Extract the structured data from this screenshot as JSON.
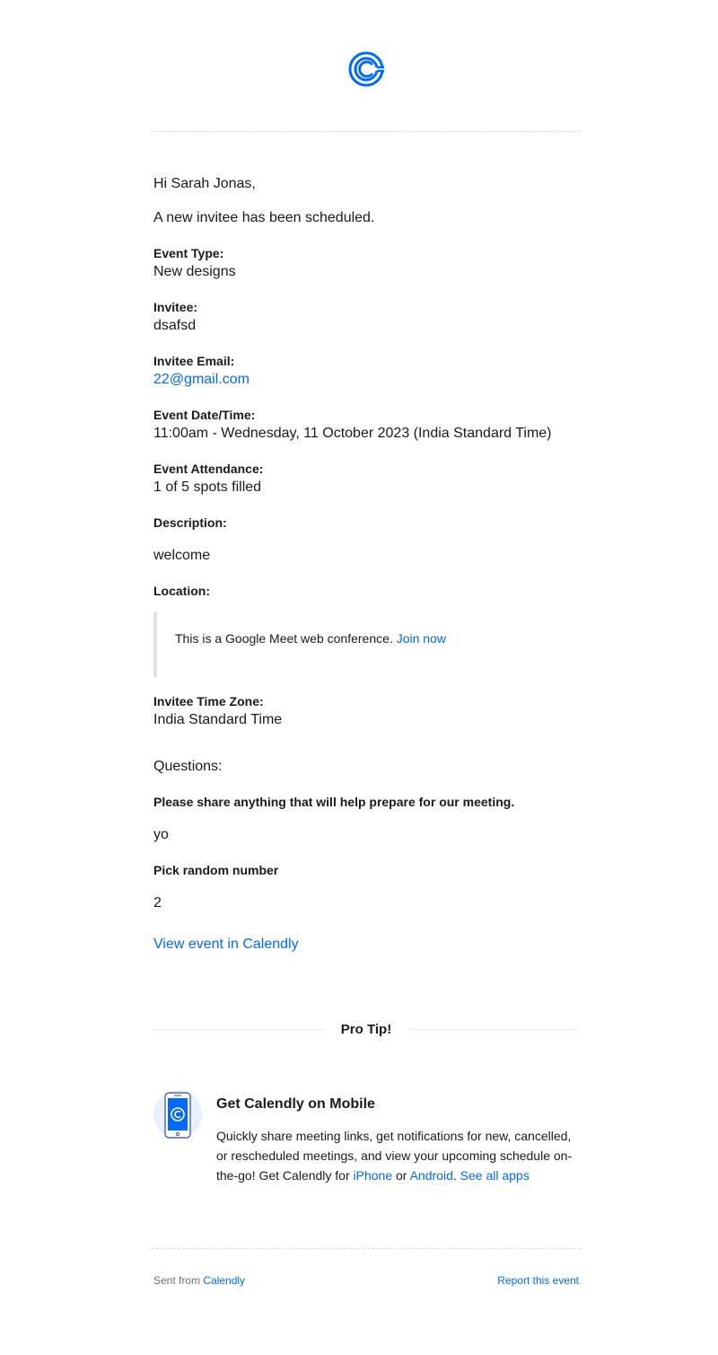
{
  "brand": {
    "logo_icon": "calendly-logo-icon",
    "accent_color": "#0069ff"
  },
  "greeting": "Hi Sarah Jonas,",
  "intro": "A new invitee has been scheduled.",
  "fields": {
    "event_type": {
      "label": "Event Type:",
      "value": "New designs"
    },
    "invitee": {
      "label": "Invitee:",
      "value": "dsafsd"
    },
    "invitee_email": {
      "label": "Invitee Email:",
      "value": "22@gmail.com"
    },
    "event_datetime": {
      "label": "Event Date/Time:",
      "value": "11:00am - Wednesday, 11 October 2023 (India Standard Time)"
    },
    "event_attendance": {
      "label": "Event Attendance:",
      "value": "1 of 5 spots filled"
    },
    "description": {
      "label": "Description:",
      "value": "welcome"
    },
    "location": {
      "label": "Location:",
      "text": "This is a Google Meet web conference.",
      "link": "Join now"
    },
    "invitee_timezone": {
      "label": "Invitee Time Zone:",
      "value": "India Standard Time"
    }
  },
  "questions": {
    "heading": "Questions:",
    "items": [
      {
        "question": "Please share anything that will help prepare for our meeting.",
        "answer": "yo"
      },
      {
        "question": "Pick random number",
        "answer": "2"
      }
    ]
  },
  "view_event_link": "View event in Calendly",
  "pro_tip": {
    "title": "Pro Tip!",
    "icon": "mobile-phone-icon",
    "heading": "Get Calendly on Mobile",
    "desc_text": "Quickly share meeting links, get notifications for new, cancelled, or rescheduled meetings, and view your upcoming schedule on-the-go! Get Calendly for ",
    "iphone_link": "iPhone",
    "or_text": " or ",
    "android_link": "Android",
    "period": ". ",
    "see_all_link": "See all apps"
  },
  "footer": {
    "sent_from": "Sent from ",
    "calendly_link": "Calendly",
    "report_link": "Report this event"
  }
}
